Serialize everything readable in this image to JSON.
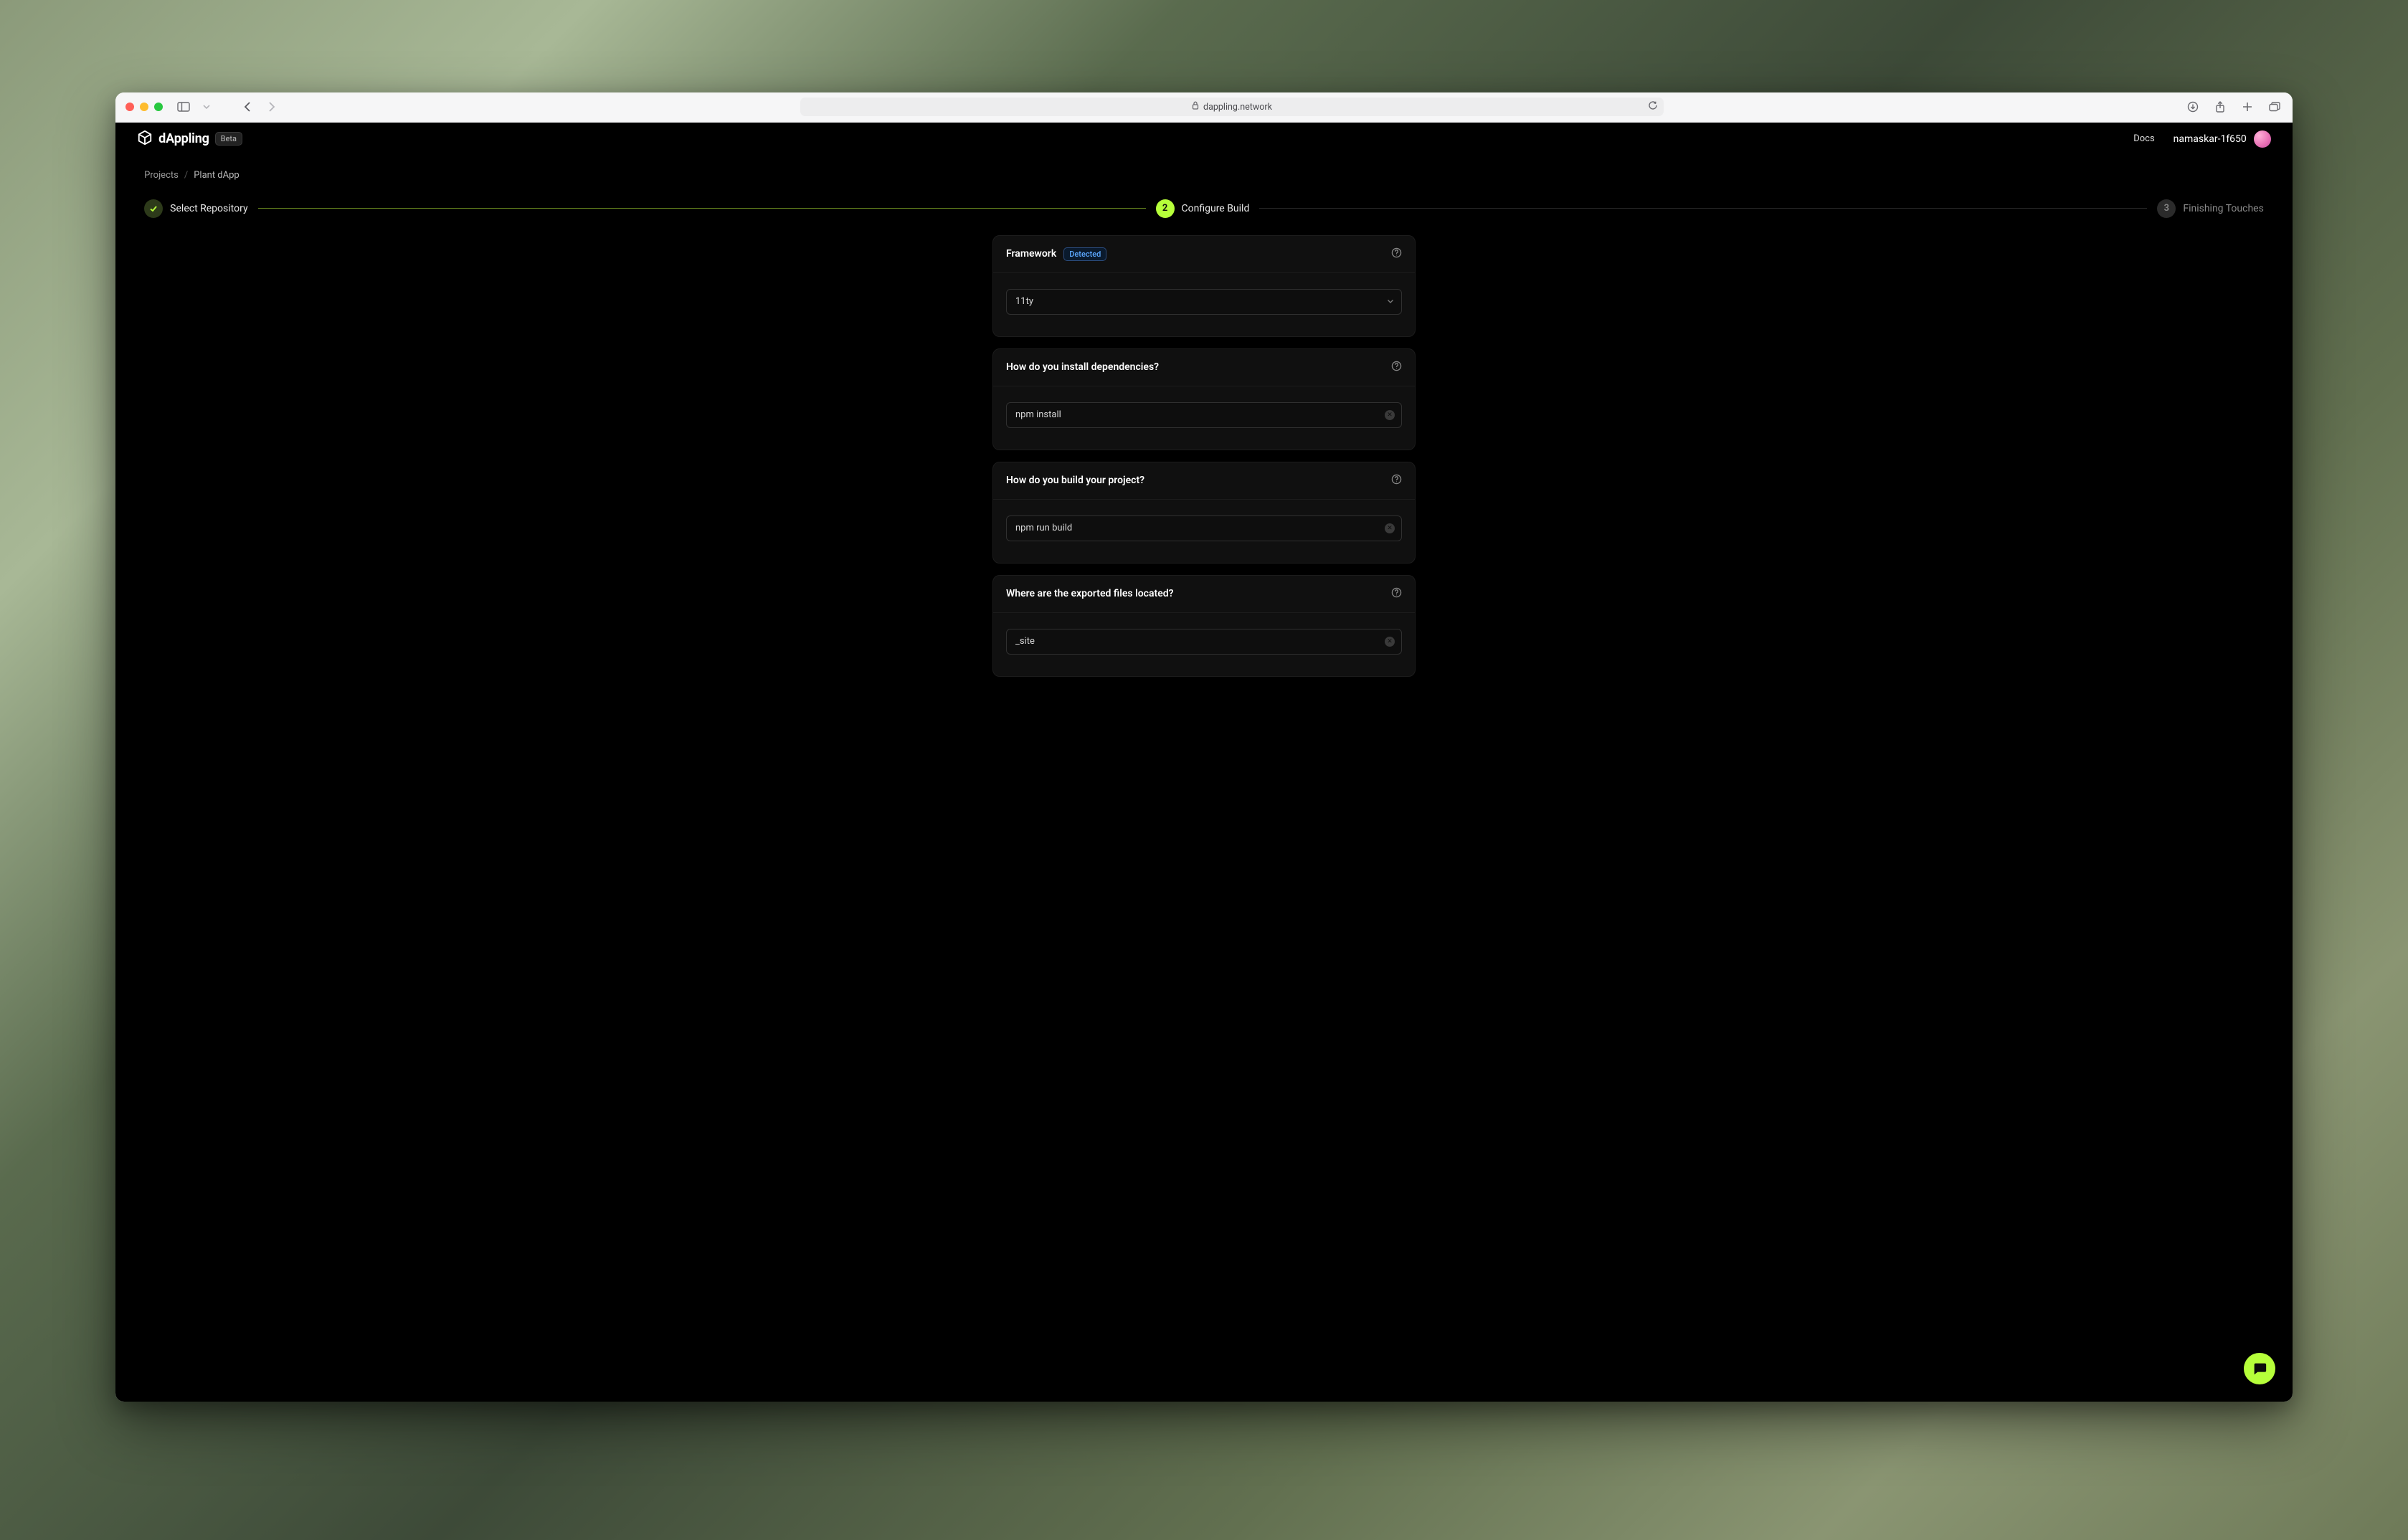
{
  "browser": {
    "url": "dappling.network"
  },
  "header": {
    "brand": "dAppling",
    "beta_label": "Beta",
    "docs_label": "Docs",
    "user_name": "namaskar-1f650"
  },
  "breadcrumbs": {
    "root": "Projects",
    "current": "Plant dApp"
  },
  "stepper": {
    "step1": {
      "label": "Select Repository"
    },
    "step2": {
      "num": "2",
      "label": "Configure Build"
    },
    "step3": {
      "num": "3",
      "label": "Finishing Touches"
    }
  },
  "cards": {
    "framework": {
      "title": "Framework",
      "badge": "Detected",
      "value": "11ty"
    },
    "install": {
      "title": "How do you install dependencies?",
      "value": "npm install"
    },
    "build": {
      "title": "How do you build your project?",
      "value": "npm run build"
    },
    "output": {
      "title": "Where are the exported files located?",
      "value": "_site"
    }
  }
}
